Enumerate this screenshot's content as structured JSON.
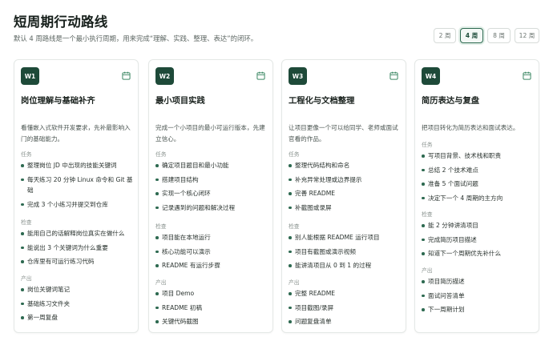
{
  "header": {
    "title": "短周期行动路线",
    "subtitle": "默认 4 周路线是一个最小执行周期，用来完成“理解、实践、整理、表达”的闭环。"
  },
  "duration_options": [
    {
      "label": "2 周",
      "selected": false
    },
    {
      "label": "4 周",
      "selected": true
    },
    {
      "label": "8 周",
      "selected": false
    },
    {
      "label": "12 周",
      "selected": false
    }
  ],
  "colors": {
    "accent": "#1e4a39",
    "bullet": "#2e6a51",
    "calendar_icon": "#3f8a66"
  },
  "cards": [
    {
      "badge": "W1",
      "icon": "calendar-icon",
      "title": "岗位理解与基础补齐",
      "desc": "看懂嵌入式软件开发要求，先补最影响入门的基础能力。",
      "tasks_label": "任务",
      "tasks": [
        "整理岗位 JD 中出现的技能关键词",
        "每天练习 20 分钟 Linux 命令和 Git 基础",
        "完成 3 个小练习并提交到仓库"
      ],
      "check_label": "检查",
      "checks": [
        "能用自己的话解释岗位真实在做什么",
        "能说出 3 个关键词为什么重要",
        "仓库里有可运行练习代码"
      ],
      "output_label": "产出",
      "outputs": [
        "岗位关键词笔记",
        "基础练习文件夹",
        "第一周复盘"
      ]
    },
    {
      "badge": "W2",
      "icon": "calendar-icon",
      "title": "最小项目实践",
      "desc": "完成一个小项目的最小可运行版本，先建立信心。",
      "tasks_label": "任务",
      "tasks": [
        "确定项目题目和最小功能",
        "搭建项目结构",
        "实现一个核心闭环",
        "记录遇到的问题和解决过程"
      ],
      "check_label": "检查",
      "checks": [
        "项目能在本地运行",
        "核心功能可以演示",
        "README 有运行步骤"
      ],
      "output_label": "产出",
      "outputs": [
        "项目 Demo",
        "README 初稿",
        "关键代码截图"
      ]
    },
    {
      "badge": "W3",
      "icon": "calendar-icon",
      "title": "工程化与文档整理",
      "desc": "让项目更像一个可以给同学、老师或面试官看的作品。",
      "tasks_label": "任务",
      "tasks": [
        "整理代码结构和命名",
        "补充异常处理或边界提示",
        "完善 README",
        "补截图或录屏"
      ],
      "check_label": "检查",
      "checks": [
        "别人能根据 README 运行项目",
        "项目有截图或演示视频",
        "能讲清项目从 0 到 1 的过程"
      ],
      "output_label": "产出",
      "outputs": [
        "完整 README",
        "项目截图/录屏",
        "问题复盘清单"
      ]
    },
    {
      "badge": "W4",
      "icon": "calendar-icon",
      "title": "简历表达与复盘",
      "desc": "把项目转化为简历表达和面试表达。",
      "tasks_label": "任务",
      "tasks": [
        "写项目背景、技术栈和职责",
        "总结 2 个技术难点",
        "准备 5 个面试问题",
        "决定下一个 4 周期的主方向"
      ],
      "check_label": "检查",
      "checks": [
        "能 2 分钟讲清项目",
        "完成简历项目描述",
        "知道下一个周期优先补什么"
      ],
      "output_label": "产出",
      "outputs": [
        "项目简历描述",
        "面试问答清单",
        "下一周期计划"
      ]
    }
  ]
}
